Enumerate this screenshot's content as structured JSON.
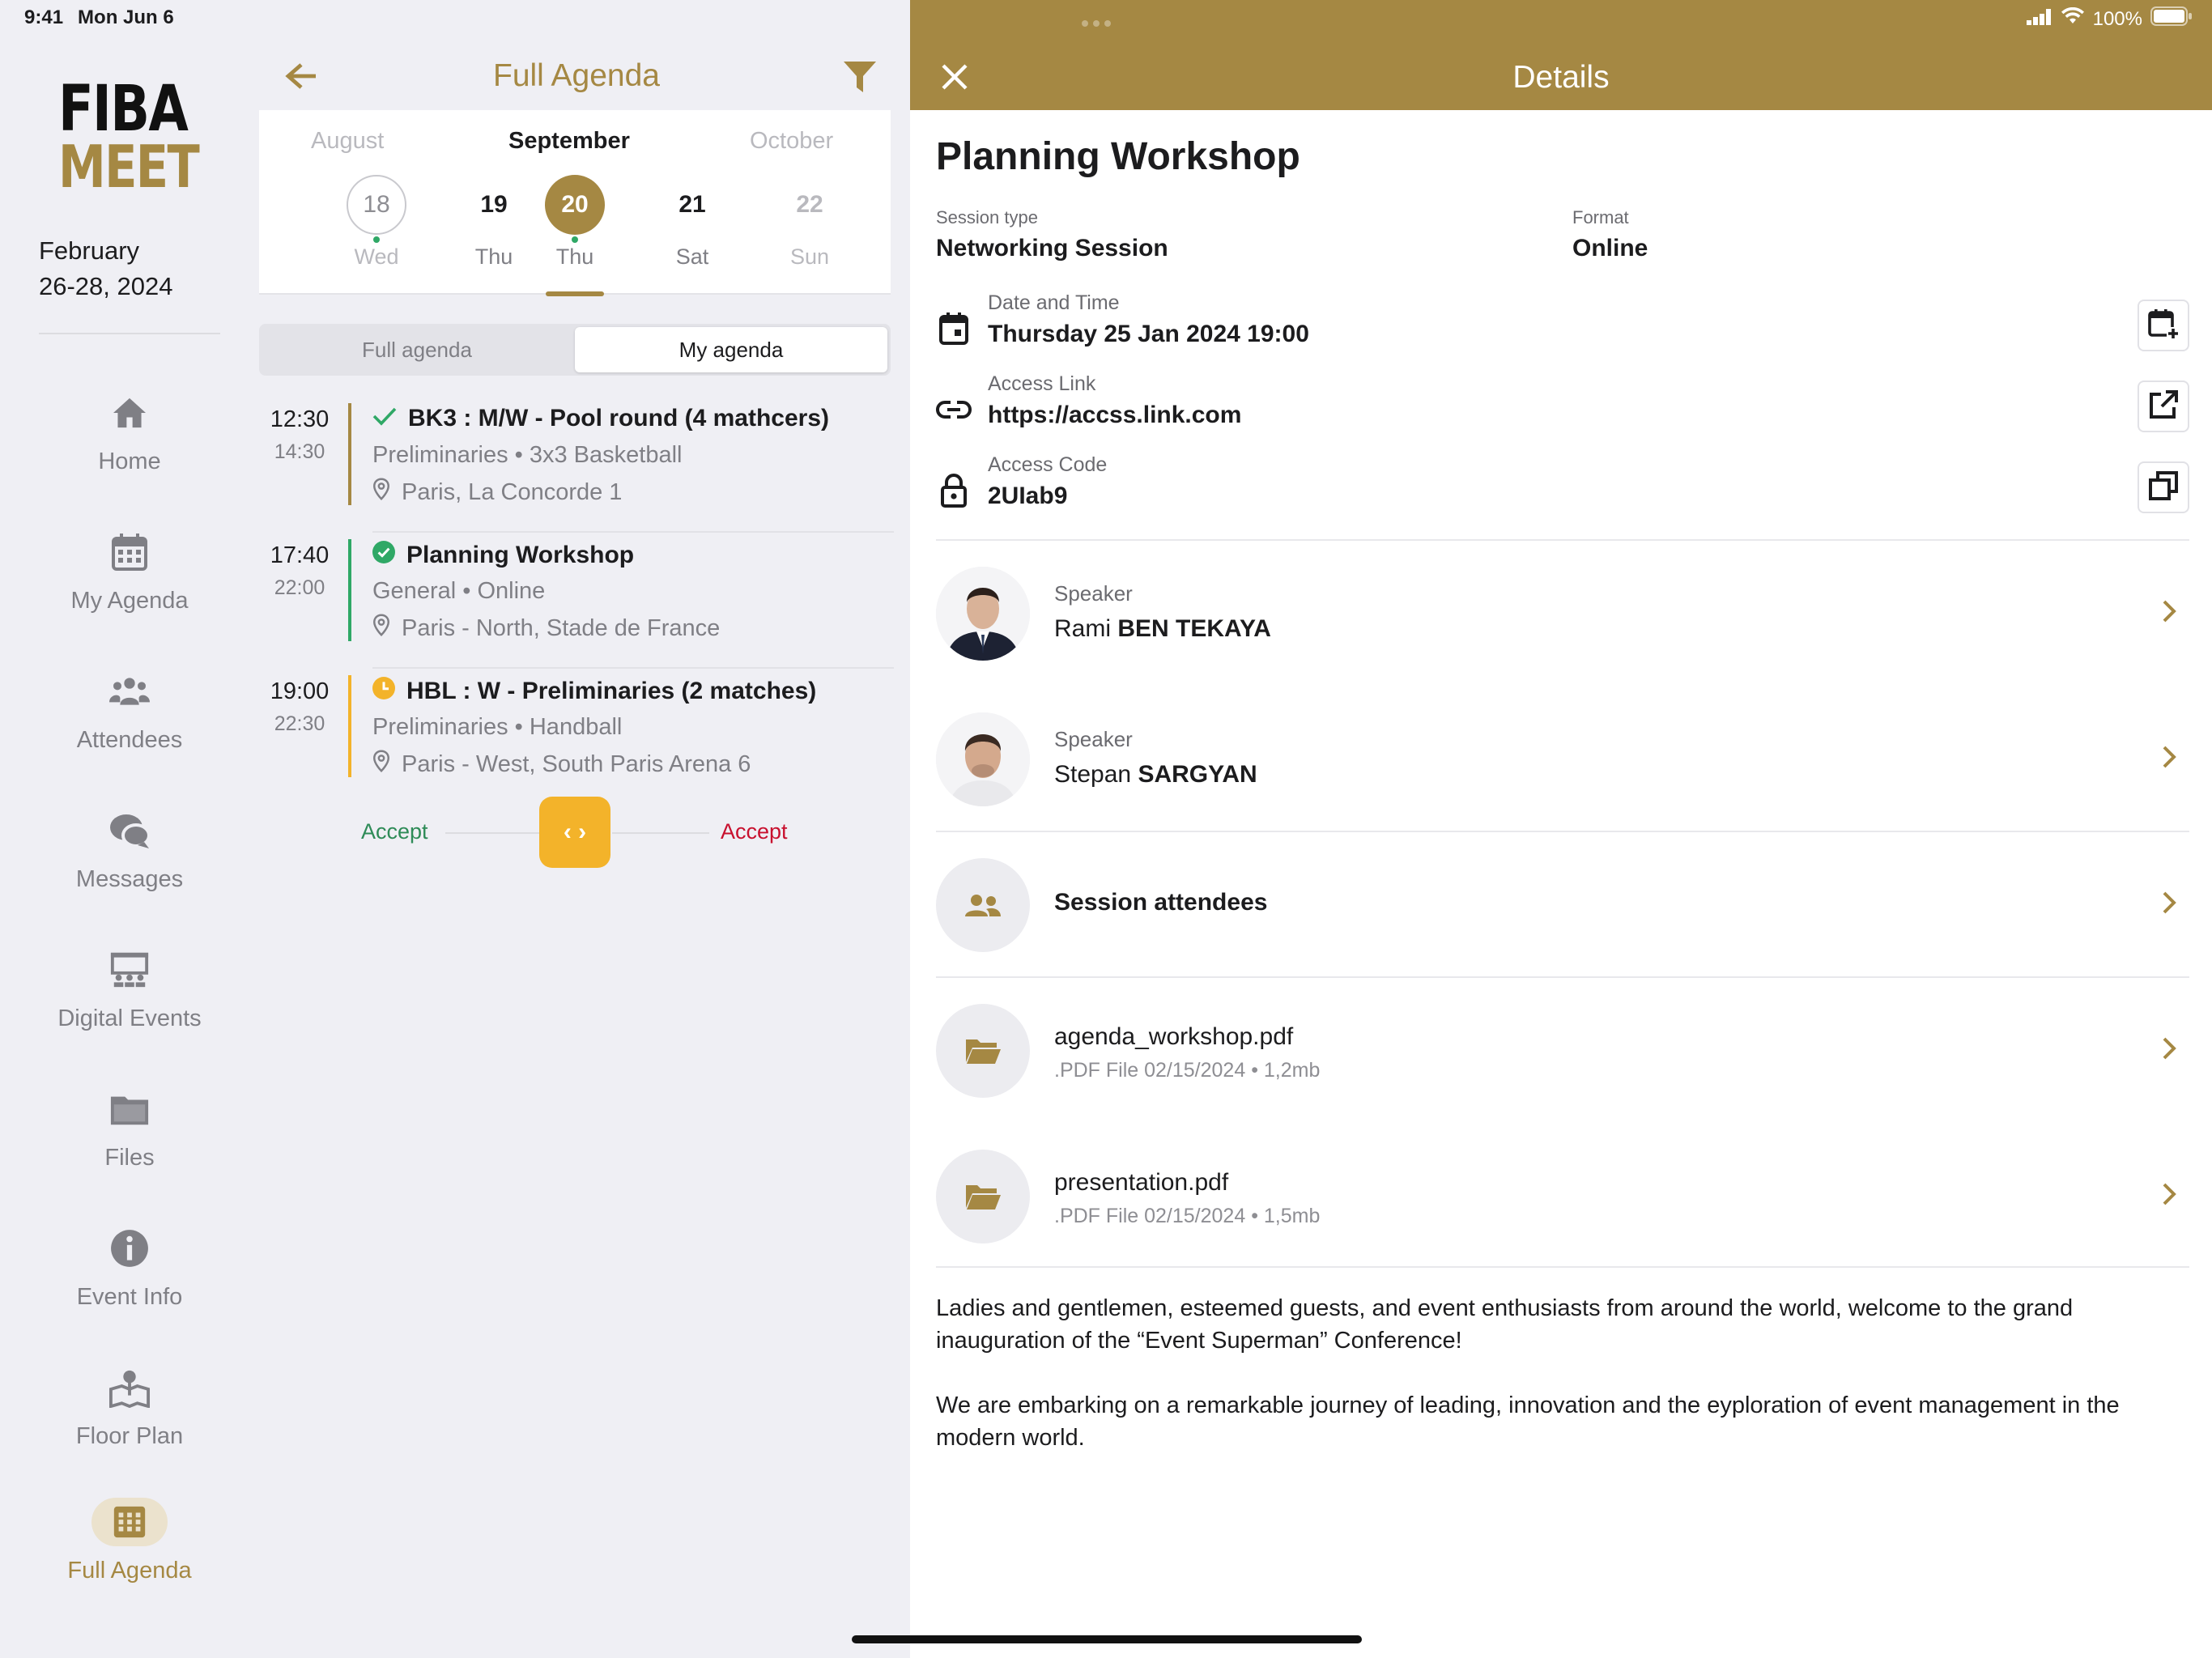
{
  "status_bar": {
    "time": "9:41",
    "date": "Mon Jun 6",
    "battery": "100%"
  },
  "sidebar": {
    "logo_line1": "FIBA",
    "logo_line2": "MEET",
    "date_line1": "February",
    "date_line2": "26-28, 2024",
    "items": [
      {
        "label": "Home",
        "icon": "home-icon"
      },
      {
        "label": "My Agenda",
        "icon": "calendar-icon"
      },
      {
        "label": "Attendees",
        "icon": "people-icon"
      },
      {
        "label": "Messages",
        "icon": "chat-icon"
      },
      {
        "label": "Digital Events",
        "icon": "stage-icon"
      },
      {
        "label": "Files",
        "icon": "folder-icon"
      },
      {
        "label": "Event Info",
        "icon": "info-icon"
      },
      {
        "label": "Floor Plan",
        "icon": "floor-plan-icon"
      },
      {
        "label": "Full Agenda",
        "icon": "grid-icon"
      }
    ]
  },
  "agenda": {
    "title": "Full Agenda",
    "months": {
      "prev": "August",
      "current": "September",
      "next": "October"
    },
    "days": [
      {
        "num": "18",
        "wd": "Wed"
      },
      {
        "num": "19",
        "wd": "Thu"
      },
      {
        "num": "20",
        "wd": "Thu"
      },
      {
        "num": "21",
        "wd": "Sat"
      },
      {
        "num": "22",
        "wd": "Sun"
      }
    ],
    "tabs": {
      "full": "Full agenda",
      "mine": "My agenda"
    },
    "sessions": [
      {
        "start": "12:30",
        "end": "14:30",
        "title": "BK3 : M/W - Pool round (4 mathcers)",
        "subtitle": "Preliminaries • 3x3 Basketball",
        "location": "Paris, La Concorde 1",
        "status_color": "#a58843"
      },
      {
        "start": "17:40",
        "end": "22:00",
        "title": "Planning Workshop",
        "subtitle": "General • Online",
        "location": "Paris - North, Stade de France",
        "status_color": "#2fa866"
      },
      {
        "start": "19:00",
        "end": "22:30",
        "title": "HBL : W - Preliminaries (2 matches)",
        "subtitle": "Preliminaries • Handball",
        "location": "Paris - West, South Paris Arena 6",
        "status_color": "#f3b32a"
      }
    ],
    "swipe": {
      "left": "Accept",
      "right": "Accept"
    }
  },
  "details": {
    "header_title": "Details",
    "title": "Planning Workshop",
    "session_type_label": "Session type",
    "session_type": "Networking Session",
    "format_label": "Format",
    "format": "Online",
    "date_label": "Date and Time",
    "date_value": "Thursday 25 Jan 2024 19:00",
    "link_label": "Access Link",
    "link_value": "https://accss.link.com",
    "code_label": "Access Code",
    "code_value": "2UIab9",
    "speakers": [
      {
        "role": "Speaker",
        "first": "Rami",
        "last": "BEN TEKAYA"
      },
      {
        "role": "Speaker",
        "first": "Stepan",
        "last": "SARGYAN"
      }
    ],
    "attendees_label": "Session attendees",
    "files": [
      {
        "name": "agenda_workshop.pdf",
        "meta": ".PDF File 02/15/2024 • 1,2mb"
      },
      {
        "name": "presentation.pdf",
        "meta": ".PDF File 02/15/2024 • 1,5mb"
      }
    ],
    "description": [
      "Ladies and gentlemen, esteemed guests, and event enthusiasts from around the world, welcome to the grand inauguration of the “Event Superman” Conference!",
      "We are embarking on a remarkable journey of leading, innovation and the eyploration of event management in the modern world."
    ]
  },
  "colors": {
    "accent": "#a58843",
    "accept_green": "#2e8b57",
    "accept_red": "#c8102e"
  }
}
